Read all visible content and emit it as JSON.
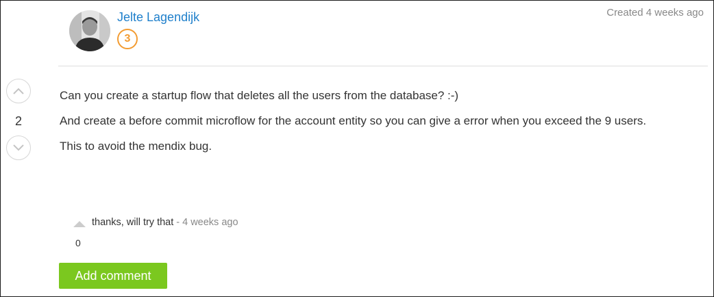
{
  "author": {
    "name": "Jelte Lagendijk",
    "reputation": "3"
  },
  "meta": {
    "created": "Created 4 weeks ago"
  },
  "votes": {
    "count": "2",
    "up_icon": "chevron-up-icon",
    "down_icon": "chevron-down-icon"
  },
  "answer": {
    "paragraphs": [
      "Can you create a startup flow that deletes all the users from the database? :-)",
      "And create a before commit microflow for the account entity so you can give a error when you exceed the 9 users.",
      "This to avoid the mendix bug."
    ]
  },
  "comments": [
    {
      "text": "thanks, will try that",
      "separator": "-",
      "time": "4 weeks ago",
      "votes": "0"
    }
  ],
  "actions": {
    "add_comment_label": "Add comment"
  },
  "colors": {
    "link": "#1e7fcb",
    "badge": "#f39c32",
    "button": "#7bc81f",
    "muted": "#888888"
  }
}
